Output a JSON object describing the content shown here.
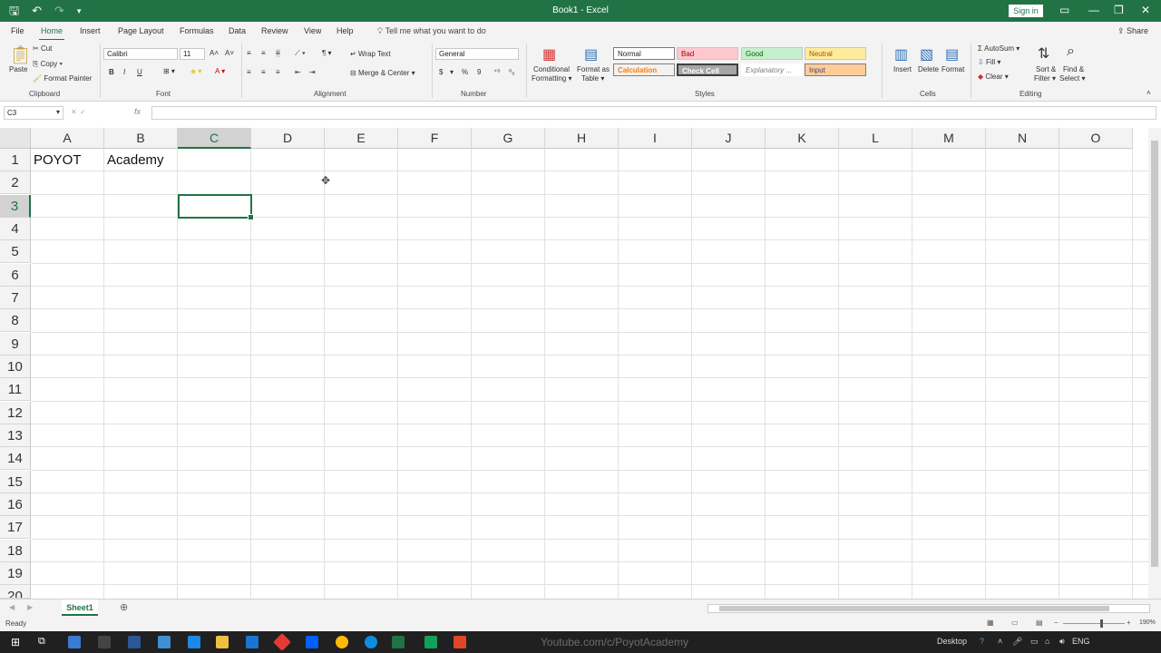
{
  "window": {
    "title": "Book1 - Excel",
    "sign_in": "Sign in"
  },
  "tabs": [
    {
      "label": "File"
    },
    {
      "label": "Home"
    },
    {
      "label": "Insert"
    },
    {
      "label": "Page Layout"
    },
    {
      "label": "Formulas"
    },
    {
      "label": "Data"
    },
    {
      "label": "Review"
    },
    {
      "label": "View"
    },
    {
      "label": "Help"
    }
  ],
  "tell_me": "Tell me what you want to do",
  "share": "Share",
  "ribbon": {
    "clipboard": {
      "paste": "Paste",
      "cut": "Cut",
      "copy": "Copy",
      "format_painter": "Format Painter",
      "group": "Clipboard"
    },
    "font": {
      "name": "Calibri",
      "size": "11",
      "bold": "B",
      "italic": "I",
      "underline": "U",
      "group": "Font"
    },
    "alignment": {
      "wrap_text": "Wrap Text",
      "merge_center": "Merge & Center",
      "group": "Alignment"
    },
    "number": {
      "format": "General",
      "currency": "$",
      "percent": "%",
      "comma": "9",
      "group": "Number"
    },
    "styles": {
      "conditional_formatting_1": "Conditional",
      "conditional_formatting_2": "Formatting",
      "format_as_table_1": "Format as",
      "format_as_table_2": "Table",
      "normal": "Normal",
      "bad": "Bad",
      "good": "Good",
      "neutral": "Neutral",
      "calculation": "Calculation",
      "check_cell": "Check Cell",
      "explanatory": "Explanatory ...",
      "input": "Input",
      "group": "Styles"
    },
    "cells": {
      "insert": "Insert",
      "delete": "Delete",
      "format": "Format",
      "group": "Cells"
    },
    "editing": {
      "autosum": "AutoSum",
      "fill": "Fill",
      "clear": "Clear",
      "sort_filter_1": "Sort &",
      "sort_filter_2": "Filter",
      "find_select_1": "Find &",
      "find_select_2": "Select",
      "group": "Editing"
    }
  },
  "formula_bar": {
    "name_box": "C3",
    "fx": "fx",
    "content": ""
  },
  "columns": [
    "A",
    "B",
    "C",
    "D",
    "E",
    "F",
    "G",
    "H",
    "I",
    "J",
    "K",
    "L",
    "M",
    "N",
    "O"
  ],
  "rows": [
    "1",
    "2",
    "3",
    "4",
    "5",
    "6",
    "7",
    "8",
    "9",
    "10",
    "11",
    "12",
    "13",
    "14",
    "15",
    "16",
    "17",
    "18",
    "19",
    "20"
  ],
  "cells": {
    "A1": "POYOT",
    "B1": "Academy"
  },
  "selected_cell": "C3",
  "sheet_tabs": [
    "Sheet1"
  ],
  "status": {
    "ready": "Ready",
    "zoom": "190%"
  },
  "taskbar": {
    "watermark": "Youtube.com/c/PoyotAcademy",
    "desktop": "Desktop",
    "lang": "ENG"
  },
  "colors": {
    "accent": "#217346"
  }
}
